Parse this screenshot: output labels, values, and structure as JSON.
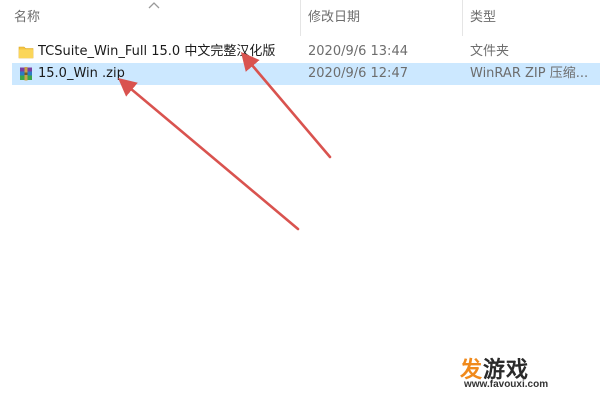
{
  "columns": {
    "name": "名称",
    "modified": "修改日期",
    "type": "类型"
  },
  "files": [
    {
      "name": "TCSuite_Win_Full 15.0 中文完整汉化版",
      "modified": "2020/9/6 13:44",
      "type": "文件夹",
      "icon": "folder-icon",
      "selected": false
    },
    {
      "name": "15.0_Win .zip",
      "modified": "2020/9/6 12:47",
      "type": "WinRAR ZIP 压缩...",
      "icon": "winrar-archive-icon",
      "selected": true
    }
  ],
  "colors": {
    "selection": "#cce8ff",
    "arrow": "#d9534f",
    "header_text": "#6d6d6d"
  },
  "watermark": {
    "main_prefix": "发",
    "main_rest": "游戏",
    "url": "www.favouxi.com"
  }
}
